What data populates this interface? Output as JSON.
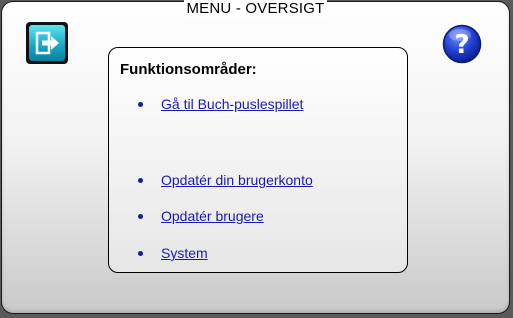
{
  "window": {
    "title": "MENU - OVERSIGT"
  },
  "toolbar": {
    "exit_icon": "exit-icon",
    "help_icon": "help-question-icon",
    "help_color": "#1e3fd0"
  },
  "panel": {
    "heading": "Funktionsområder:",
    "links": [
      {
        "label": "Gå til Buch-puslespillet"
      },
      {
        "label": "Opdatér din brugerkonto"
      },
      {
        "label": "Opdatér brugere"
      },
      {
        "label": "System"
      }
    ]
  },
  "colors": {
    "link": "#1a1ab4",
    "exit_button": "#1aa9c6"
  }
}
